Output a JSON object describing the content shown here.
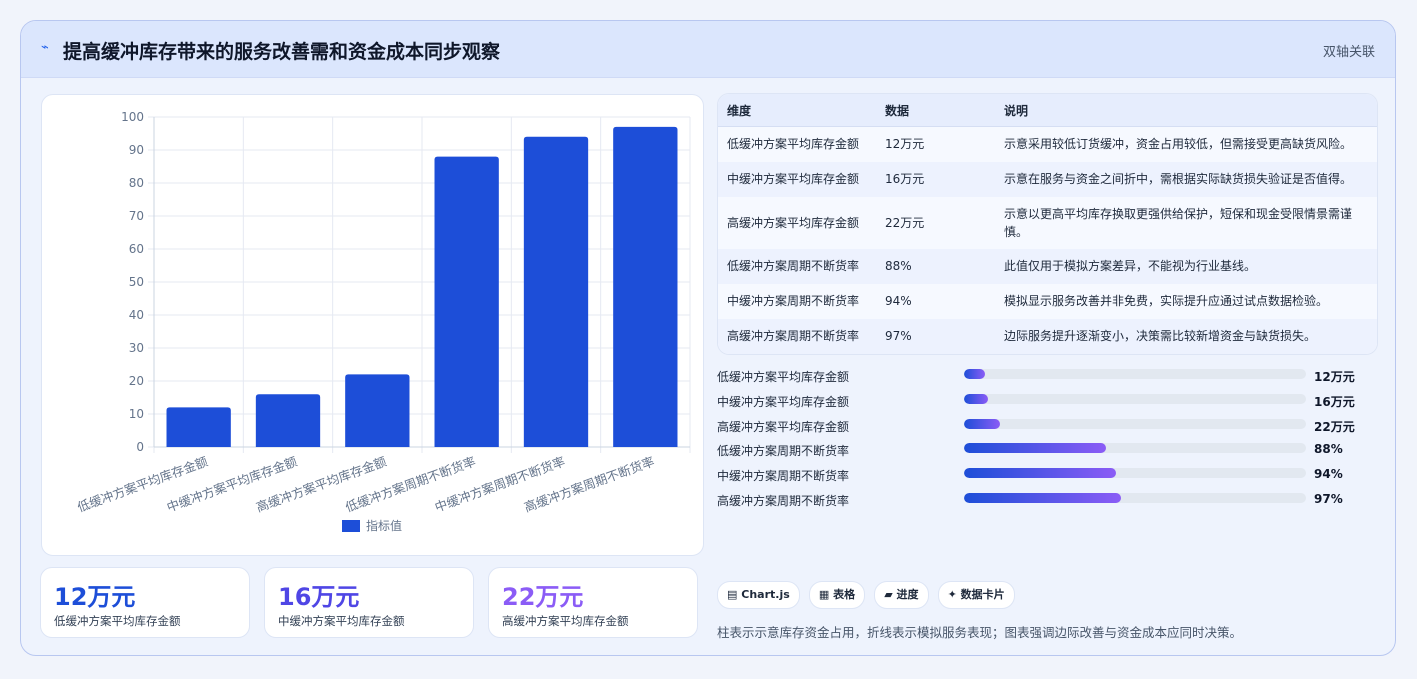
{
  "header": {
    "icon": "chart-line-icon",
    "title": "提高缓冲库存带来的服务改善需和资金成本同步观察",
    "badge": "双轴关联"
  },
  "chart_data": {
    "type": "bar",
    "categories": [
      "低缓冲方案平均库存金额",
      "中缓冲方案平均库存金额",
      "高缓冲方案平均库存金额",
      "低缓冲方案周期不断货率",
      "中缓冲方案周期不断货率",
      "高缓冲方案周期不断货率"
    ],
    "series": [
      {
        "name": "指标值",
        "values": [
          12,
          16,
          22,
          88,
          94,
          97
        ]
      }
    ],
    "ylim": [
      0,
      100
    ],
    "yticks": [
      "0",
      "10",
      "20",
      "30",
      "40",
      "50",
      "60",
      "70",
      "80",
      "90",
      "100"
    ],
    "grid": true,
    "legend_position": "bottom",
    "bar_color": "#1d4ed8"
  },
  "kpis": [
    {
      "value": "12万元",
      "label": "低缓冲方案平均库存金额",
      "color": "#1d4ed8"
    },
    {
      "value": "16万元",
      "label": "中缓冲方案平均库存金额",
      "color": "#4f46e5"
    },
    {
      "value": "22万元",
      "label": "高缓冲方案平均库存金额",
      "color": "#8b5cf6"
    }
  ],
  "table": {
    "headers": [
      "维度",
      "数据",
      "说明"
    ],
    "rows": [
      [
        "低缓冲方案平均库存金额",
        "12万元",
        "示意采用较低订货缓冲，资金占用较低，但需接受更高缺货风险。"
      ],
      [
        "中缓冲方案平均库存金额",
        "16万元",
        "示意在服务与资金之间折中，需根据实际缺货损失验证是否值得。"
      ],
      [
        "高缓冲方案平均库存金额",
        "22万元",
        "示意以更高平均库存换取更强供给保护，短保和现金受限情景需谨慎。"
      ],
      [
        "低缓冲方案周期不断货率",
        "88%",
        "此值仅用于模拟方案差异，不能视为行业基线。"
      ],
      [
        "中缓冲方案周期不断货率",
        "94%",
        "模拟显示服务改善并非免费，实际提升应通过试点数据检验。"
      ],
      [
        "高缓冲方案周期不断货率",
        "97%",
        "边际服务提升逐渐变小，决策需比较新增资金与缺货损失。"
      ]
    ]
  },
  "progress": [
    {
      "label": "低缓冲方案平均库存金额",
      "value": "12万元",
      "fraction": 0.06
    },
    {
      "label": "中缓冲方案平均库存金额",
      "value": "16万元",
      "fraction": 0.07
    },
    {
      "label": "高缓冲方案平均库存金额",
      "value": "22万元",
      "fraction": 0.105
    },
    {
      "label": "低缓冲方案周期不断货率",
      "value": "88%",
      "fraction": 0.415
    },
    {
      "label": "中缓冲方案周期不断货率",
      "value": "94%",
      "fraction": 0.445
    },
    {
      "label": "高缓冲方案周期不断货率",
      "value": "97%",
      "fraction": 0.46
    }
  ],
  "chips": [
    {
      "icon": "chart-icon",
      "glyph": "▤",
      "label": "Chart.js"
    },
    {
      "icon": "table-icon",
      "glyph": "▦",
      "label": "表格"
    },
    {
      "icon": "progress-icon",
      "glyph": "▰",
      "label": "进度"
    },
    {
      "icon": "sparkle-icon",
      "glyph": "✦",
      "label": "数据卡片"
    }
  ],
  "footnote": "柱表示示意库存资金占用，折线表示模拟服务表现；图表强调边际改善与资金成本应同时决策。"
}
